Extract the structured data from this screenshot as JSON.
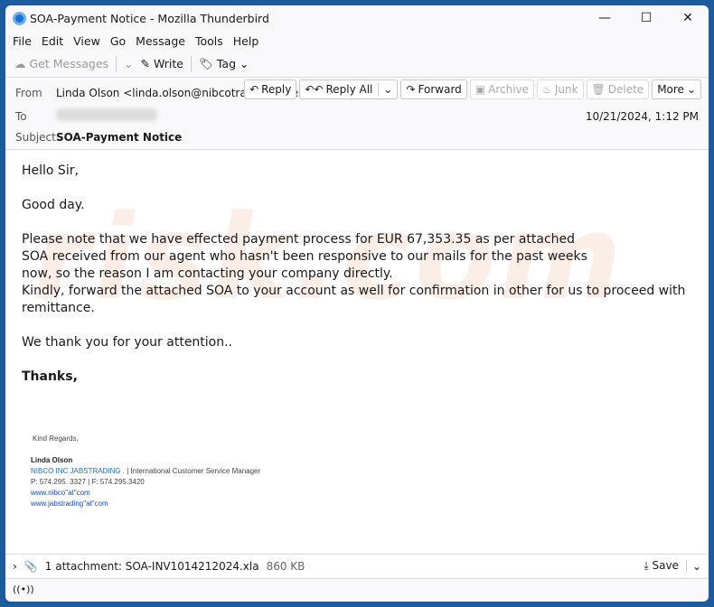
{
  "window": {
    "title": "SOA-Payment Notice - Mozilla Thunderbird"
  },
  "menu": [
    "File",
    "Edit",
    "View",
    "Go",
    "Message",
    "Tools",
    "Help"
  ],
  "toolbar": {
    "get_messages": "Get Messages",
    "write": "Write",
    "tag": "Tag"
  },
  "header": {
    "from_label": "From",
    "from_value": "Linda Olson <linda.olson@nibcotradings.live>",
    "to_label": "To",
    "subject_label": "Subject",
    "subject_value": "SOA-Payment Notice",
    "date": "10/21/2024, 1:12 PM",
    "buttons": {
      "reply": "Reply",
      "reply_all": "Reply All",
      "forward": "Forward",
      "archive": "Archive",
      "junk": "Junk",
      "delete": "Delete",
      "more": "More"
    }
  },
  "body": {
    "greeting": "Hello Sir,",
    "p1": "Good day.",
    "p2a": "Please note that we have effected payment process for EUR 67,353.35 as per attached SOA received from our agent who hasn't been responsive to our mails for the past weeks now, so the reason I am contacting your company directly.",
    "p2b": "Kindly, forward the attached SOA to your account as well for confirmation in other for us to proceed with remittance.",
    "p3": "We thank you for your attention..",
    "closing": "Thanks,"
  },
  "watermark": "risk.com",
  "signature": {
    "regards": "Kind Regards,",
    "name": "Linda Olson",
    "company": "NIBCO INC JABSTRADING .",
    "title": " | International Customer Service Manager",
    "phone": "P: 574.295. 3327 | F: 574.295.3420",
    "link1": "www.nibco\"at\"com",
    "link2": "www.jabstrading\"at\"com"
  },
  "attachment": {
    "text": "1 attachment: SOA-INV1014212024.xla",
    "size": "860 KB",
    "save": "Save"
  }
}
